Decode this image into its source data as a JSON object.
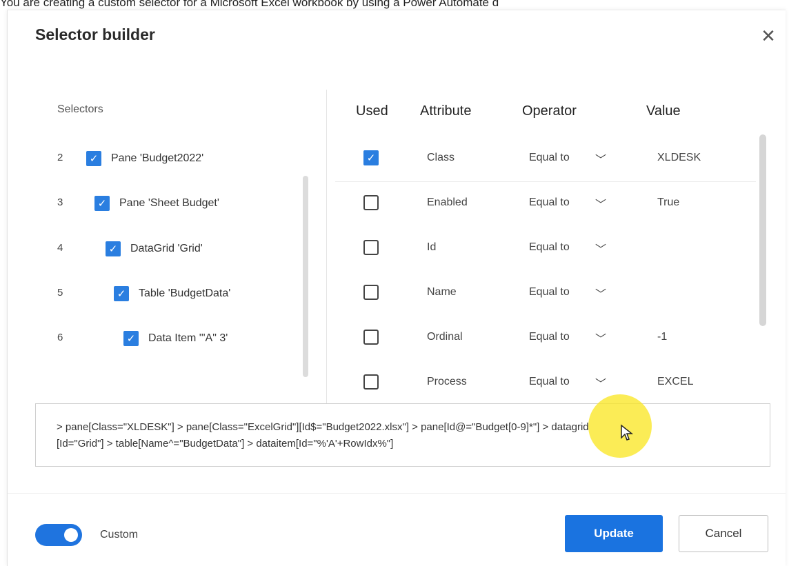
{
  "caption": "You are creating a custom selector for a Microsoft Excel workbook by using a Power Automate d",
  "dialog": {
    "title": "Selector builder",
    "close_icon": "close-icon"
  },
  "selectors": {
    "header": "Selectors",
    "items": [
      {
        "num": "2",
        "label": "Pane 'Budget2022'",
        "checked": true
      },
      {
        "num": "3",
        "label": "Pane 'Sheet Budget'",
        "checked": true
      },
      {
        "num": "4",
        "label": "DataGrid 'Grid'",
        "checked": true
      },
      {
        "num": "5",
        "label": "Table 'BudgetData'",
        "checked": true
      },
      {
        "num": "6",
        "label": "Data Item '\"A\" 3'",
        "checked": true
      }
    ]
  },
  "attributes": {
    "headers": {
      "used": "Used",
      "attribute": "Attribute",
      "operator": "Operator",
      "value": "Value"
    },
    "rows": [
      {
        "used": true,
        "attribute": "Class",
        "operator": "Equal to",
        "value": "XLDESK"
      },
      {
        "used": false,
        "attribute": "Enabled",
        "operator": "Equal to",
        "value": "True"
      },
      {
        "used": false,
        "attribute": "Id",
        "operator": "Equal to",
        "value": ""
      },
      {
        "used": false,
        "attribute": "Name",
        "operator": "Equal to",
        "value": ""
      },
      {
        "used": false,
        "attribute": "Ordinal",
        "operator": "Equal to",
        "value": "-1"
      },
      {
        "used": false,
        "attribute": "Process",
        "operator": "Equal to",
        "value": "EXCEL"
      }
    ]
  },
  "selector_text": {
    "line1": "> pane[Class=\"XLDESK\"] > pane[Class=\"ExcelGrid\"][Id$=\"Budget2022.xlsx\"] > pane[Id@=\"Budget[0-9]*\"] > datagrid",
    "line2": "[Id=\"Grid\"] > table[Name^=\"BudgetData\"] > dataitem[Id=\"%'A'+RowIdx%\"]"
  },
  "footer": {
    "toggle_label": "Custom",
    "toggle_on": true,
    "update_label": "Update",
    "cancel_label": "Cancel"
  },
  "colors": {
    "accent": "#1a73e0",
    "checkbox": "#2a7ee0",
    "cursor_highlight": "#fae61e"
  }
}
